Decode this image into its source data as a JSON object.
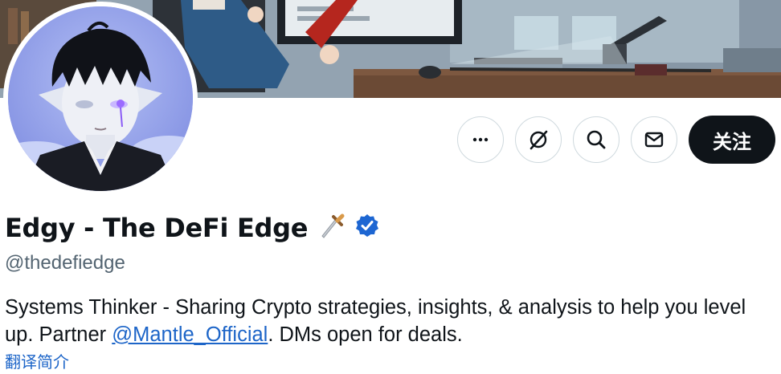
{
  "profile": {
    "display_name": "Edgy - The DeFi Edge",
    "handle": "@thedefiedge",
    "verified": true,
    "name_emoji_icon": "dagger-icon",
    "bio_text_before": "Systems Thinker - Sharing Crypto strategies, insights, & analysis to help you level up. Partner ",
    "bio_mention": "@Mantle_Official",
    "bio_text_after": ". DMs open for deals.",
    "translate_link": "翻译简介"
  },
  "actions": {
    "more_icon": "more-icon",
    "grok_icon": "grok-icon",
    "search_icon": "search-icon",
    "message_icon": "mail-icon",
    "follow_label": "关注"
  },
  "colors": {
    "follow_bg": "#0f1419",
    "link": "#1d65c8",
    "verified": "#1d9bf0",
    "muted": "#536471",
    "border": "#cfd9de"
  }
}
